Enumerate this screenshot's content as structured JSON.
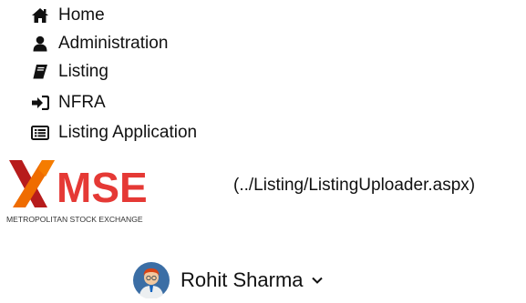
{
  "nav": {
    "items": [
      {
        "label": "Home",
        "icon": "home-icon"
      },
      {
        "label": "Administration",
        "icon": "user-icon"
      },
      {
        "label": "Listing",
        "icon": "book-icon"
      },
      {
        "label": "NFRA",
        "icon": "sign-in-icon"
      },
      {
        "label": "Listing Application",
        "icon": "list-alt-icon"
      }
    ]
  },
  "logo": {
    "main_text": "MSE",
    "tagline": "METROPOLITAN STOCK EXCHANGE",
    "colors": {
      "x_red": "#c62828",
      "x_orange": "#ef6c00",
      "brand": "#e53935"
    }
  },
  "link": {
    "text": "(../Listing/ListingUploader.aspx)"
  },
  "user": {
    "name": "Rohit Sharma",
    "avatar_color": "#3b6ea5"
  }
}
